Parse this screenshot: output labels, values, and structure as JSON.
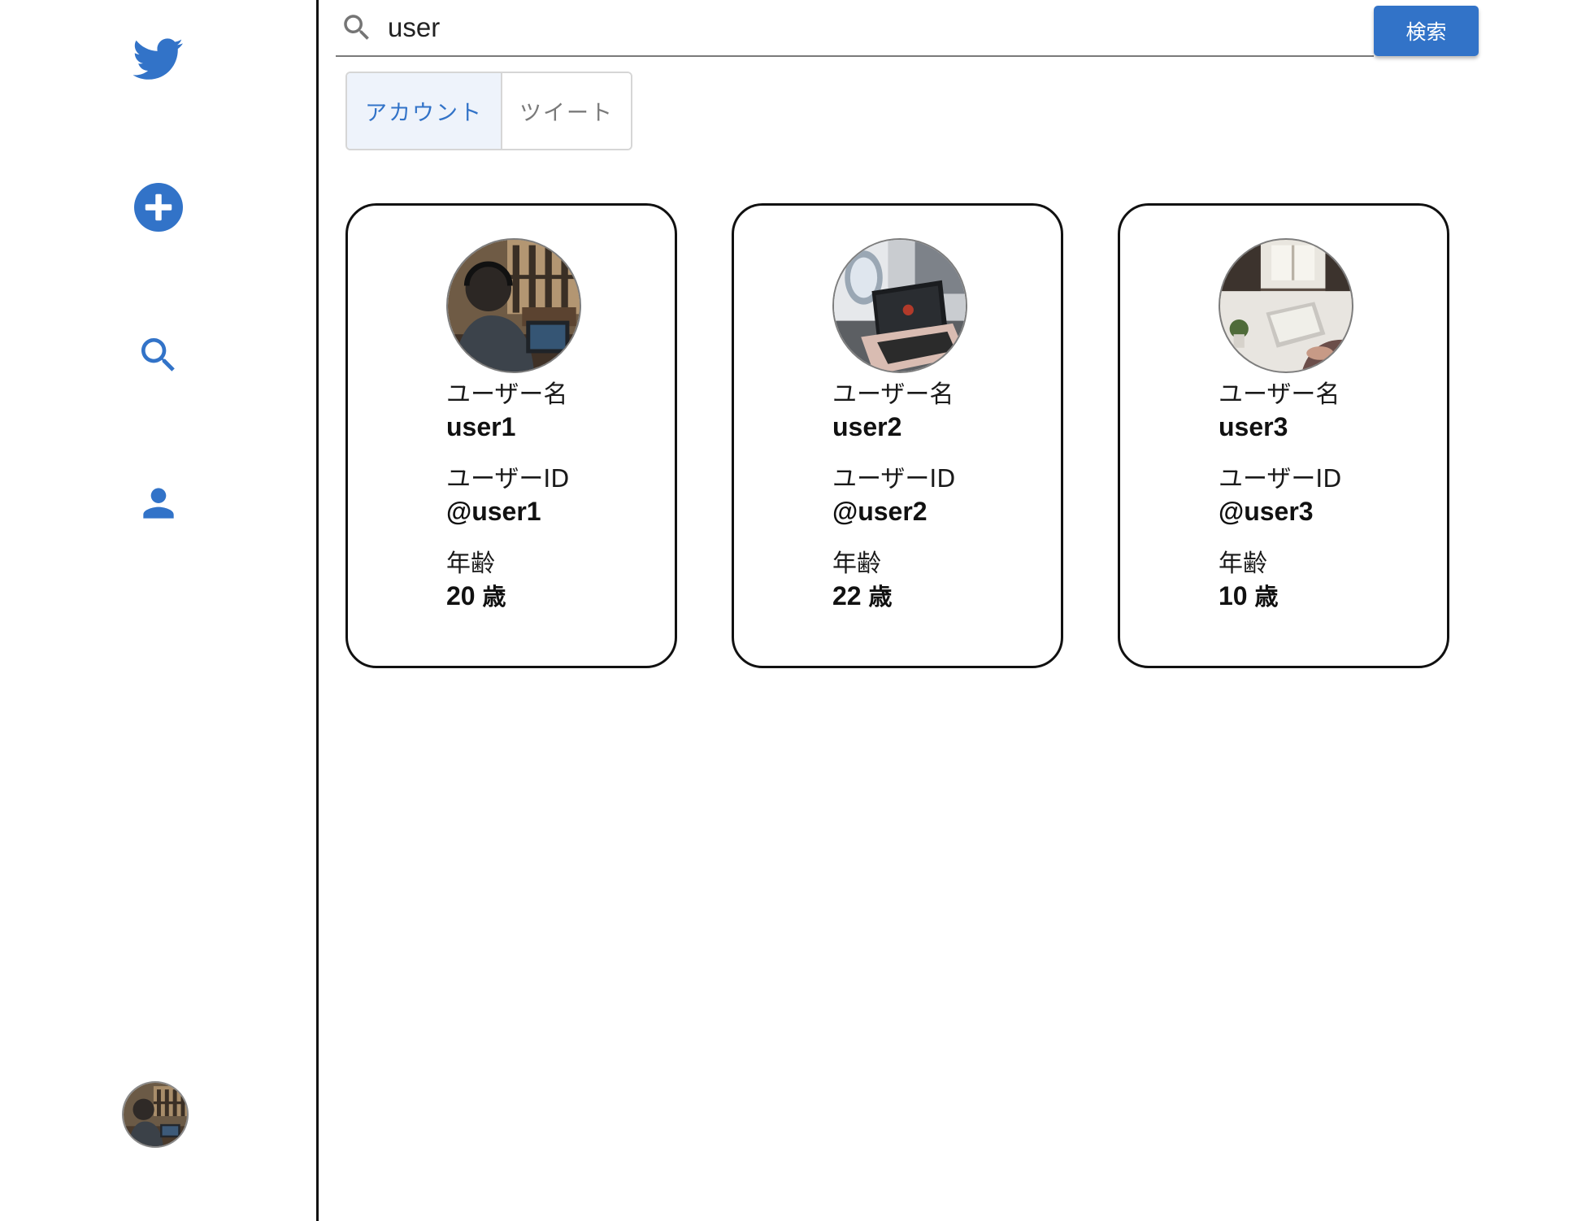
{
  "sidebar": {
    "logo_icon": "bird-logo-icon",
    "nav_items": [
      {
        "name": "create-post",
        "icon": "plus-circle-icon"
      },
      {
        "name": "search",
        "icon": "search-icon"
      },
      {
        "name": "profile",
        "icon": "person-icon"
      }
    ],
    "accent_color": "#3273c8"
  },
  "search": {
    "value": "user",
    "button_label": "検索"
  },
  "tabs": [
    {
      "label": "アカウント",
      "active": true
    },
    {
      "label": "ツイート",
      "active": false
    }
  ],
  "cards": [
    {
      "name_label": "ユーザー名",
      "name": "user1",
      "id_label": "ユーザーID",
      "id": "@user1",
      "age_label": "年齢",
      "age": "20",
      "age_unit": "歳"
    },
    {
      "name_label": "ユーザー名",
      "name": "user2",
      "id_label": "ユーザーID",
      "id": "@user2",
      "age_label": "年齢",
      "age": "22",
      "age_unit": "歳"
    },
    {
      "name_label": "ユーザー名",
      "name": "user3",
      "id_label": "ユーザーID",
      "id": "@user3",
      "age_label": "年齢",
      "age": "10",
      "age_unit": "歳"
    }
  ]
}
